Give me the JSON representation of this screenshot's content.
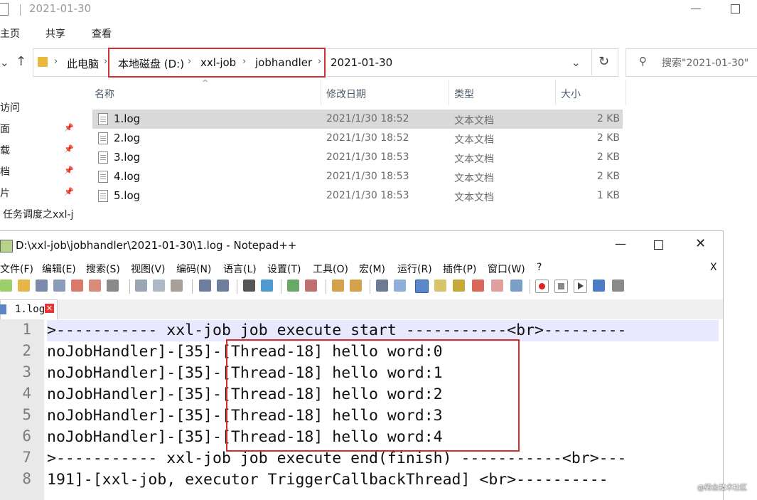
{
  "explorer": {
    "title": "2021-01-30",
    "menu": [
      "主页",
      "共享",
      "查看"
    ],
    "breadcrumbs": [
      "此电脑",
      "本地磁盘 (D:)",
      "xxl-job",
      "jobhandler",
      "2021-01-30"
    ],
    "search_placeholder": "搜索\"2021-01-30\"",
    "nav_items": [
      "访问",
      "面",
      "载",
      "档",
      "片",
      "任务调度之xxl-j"
    ],
    "columns": [
      "名称",
      "修改日期",
      "类型",
      "大小"
    ],
    "files": [
      {
        "name": "1.log",
        "date": "2021/1/30 18:52",
        "type": "文本文档",
        "size": "2 KB",
        "selected": true
      },
      {
        "name": "2.log",
        "date": "2021/1/30 18:52",
        "type": "文本文档",
        "size": "2 KB"
      },
      {
        "name": "3.log",
        "date": "2021/1/30 18:53",
        "type": "文本文档",
        "size": "2 KB"
      },
      {
        "name": "4.log",
        "date": "2021/1/30 18:53",
        "type": "文本文档",
        "size": "2 KB"
      },
      {
        "name": "5.log",
        "date": "2021/1/30 18:53",
        "type": "文本文档",
        "size": "1 KB"
      }
    ]
  },
  "notepad": {
    "title": "D:\\xxl-job\\jobhandler\\2021-01-30\\1.log - Notepad++",
    "menu": [
      "文件(F)",
      "编辑(E)",
      "搜索(S)",
      "视图(V)",
      "编码(N)",
      "语言(L)",
      "设置(T)",
      "工具(O)",
      "宏(M)",
      "运行(R)",
      "插件(P)",
      "窗口(W)",
      "?"
    ],
    "menu_close": "X",
    "tab_label": "1.log",
    "lines": [
      {
        "num": "1",
        "text": ">----------- xxl-job job execute start -----------<br>---------"
      },
      {
        "num": "2",
        "text": "noJobHandler]-[35]-[Thread-18] hello word:0"
      },
      {
        "num": "3",
        "text": "noJobHandler]-[35]-[Thread-18] hello word:1"
      },
      {
        "num": "4",
        "text": "noJobHandler]-[35]-[Thread-18] hello word:2"
      },
      {
        "num": "5",
        "text": "noJobHandler]-[35]-[Thread-18] hello word:3"
      },
      {
        "num": "6",
        "text": "noJobHandler]-[35]-[Thread-18] hello word:4"
      },
      {
        "num": "7",
        "text": ">----------- xxl-job job execute end(finish) -----------<br>---"
      },
      {
        "num": "8",
        "text": "191]-[xxl-job, executor TriggerCallbackThread] <br>----------"
      }
    ]
  },
  "watermark": "@稀金技术社区",
  "colors": {
    "highlight": "#d32f2f",
    "selected_row": "#d9d9d9",
    "current_line": "#e8e8ff"
  }
}
